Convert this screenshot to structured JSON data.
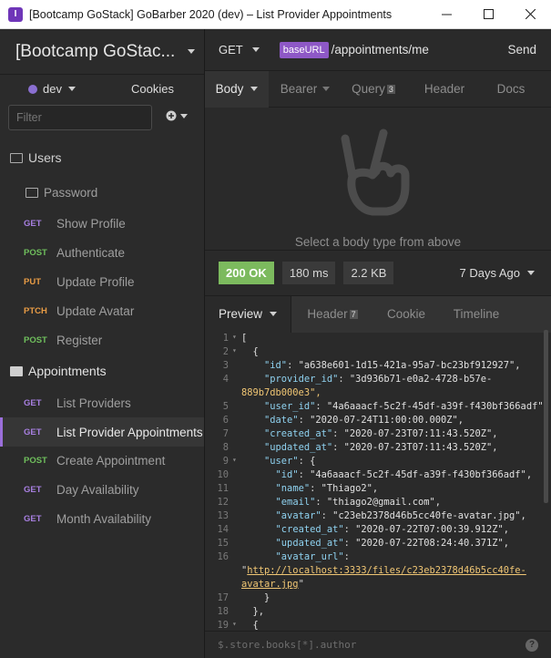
{
  "window": {
    "title": "[Bootcamp GoStack] GoBarber 2020 (dev) – List Provider Appointments",
    "app_icon_letter": "I"
  },
  "sidebar": {
    "workspace": "[Bootcamp GoStac...",
    "environment": "dev",
    "cookies_label": "Cookies",
    "filter_placeholder": "Filter",
    "items": [
      {
        "type": "folder",
        "label": "Users"
      },
      {
        "type": "folder",
        "label": "Password"
      },
      {
        "type": "request",
        "method": "GET",
        "label": "Show Profile"
      },
      {
        "type": "request",
        "method": "POST",
        "label": "Authenticate"
      },
      {
        "type": "request",
        "method": "PUT",
        "label": "Update Profile"
      },
      {
        "type": "request",
        "method": "PTCH",
        "label": "Update Avatar"
      },
      {
        "type": "request",
        "method": "POST",
        "label": "Register"
      },
      {
        "type": "folder",
        "label": "Appointments"
      },
      {
        "type": "request",
        "method": "GET",
        "label": "List Providers"
      },
      {
        "type": "request",
        "method": "GET",
        "label": "List Provider Appointments",
        "active": true
      },
      {
        "type": "request",
        "method": "POST",
        "label": "Create Appointment"
      },
      {
        "type": "request",
        "method": "GET",
        "label": "Day Availability"
      },
      {
        "type": "request",
        "method": "GET",
        "label": "Month Availability"
      }
    ]
  },
  "request": {
    "method": "GET",
    "base_url_chip": "baseURL",
    "path": "/appointments/me",
    "send_label": "Send",
    "tabs": [
      {
        "label": "Body"
      },
      {
        "label": "Bearer"
      },
      {
        "label": "Query",
        "badge": "3"
      },
      {
        "label": "Header"
      },
      {
        "label": "Docs"
      }
    ],
    "body_hint": "Select a body type from above"
  },
  "response": {
    "status": "200 OK",
    "time": "180 ms",
    "size": "2.2 KB",
    "age": "7 Days Ago",
    "tabs": [
      {
        "label": "Preview"
      },
      {
        "label": "Header",
        "badge": "7"
      },
      {
        "label": "Cookie"
      },
      {
        "label": "Timeline"
      }
    ],
    "filter_text": "$.store.books[*].author",
    "help": "?",
    "lines": [
      {
        "n": "1",
        "fold": "▾",
        "text": "["
      },
      {
        "n": "2",
        "fold": "▾",
        "text": "  {"
      },
      {
        "n": "3",
        "fold": "",
        "text": "    \"id\": \"a638e601-1d15-421a-95a7-bc23bf912927\","
      },
      {
        "n": "4",
        "fold": "",
        "text": "    \"provider_id\": \"3d936b71-e0a2-4728-b57e-"
      },
      {
        "n": "",
        "fold": "",
        "text": "889b7db000e3\","
      },
      {
        "n": "5",
        "fold": "",
        "text": "    \"user_id\": \"4a6aaacf-5c2f-45df-a39f-f430bf366adf\","
      },
      {
        "n": "6",
        "fold": "",
        "text": "    \"date\": \"2020-07-24T11:00:00.000Z\","
      },
      {
        "n": "7",
        "fold": "",
        "text": "    \"created_at\": \"2020-07-23T07:11:43.520Z\","
      },
      {
        "n": "8",
        "fold": "",
        "text": "    \"updated_at\": \"2020-07-23T07:11:43.520Z\","
      },
      {
        "n": "9",
        "fold": "▾",
        "text": "    \"user\": {"
      },
      {
        "n": "10",
        "fold": "",
        "text": "      \"id\": \"4a6aaacf-5c2f-45df-a39f-f430bf366adf\","
      },
      {
        "n": "11",
        "fold": "",
        "text": "      \"name\": \"Thiago2\","
      },
      {
        "n": "12",
        "fold": "",
        "text": "      \"email\": \"thiago2@gmail.com\","
      },
      {
        "n": "13",
        "fold": "",
        "text": "      \"avatar\": \"c23eb2378d46b5cc40fe-avatar.jpg\","
      },
      {
        "n": "14",
        "fold": "",
        "text": "      \"created_at\": \"2020-07-22T07:00:39.912Z\","
      },
      {
        "n": "15",
        "fold": "",
        "text": "      \"updated_at\": \"2020-07-22T08:24:40.371Z\","
      },
      {
        "n": "16",
        "fold": "",
        "text": "      \"avatar_url\":"
      },
      {
        "n": "",
        "fold": "",
        "text": "\"http://localhost:3333/files/c23eb2378d46b5cc40fe-"
      },
      {
        "n": "",
        "fold": "",
        "text": "avatar.jpg\""
      },
      {
        "n": "17",
        "fold": "",
        "text": "    }"
      },
      {
        "n": "18",
        "fold": "",
        "text": "  },"
      },
      {
        "n": "19",
        "fold": "▾",
        "text": "  {"
      }
    ]
  },
  "colors": {
    "accent": "#9b6fdb",
    "status_ok": "#7cba5e",
    "method_get": "#a77fe0",
    "method_post": "#6fbf5c",
    "method_put": "#e79b45"
  }
}
